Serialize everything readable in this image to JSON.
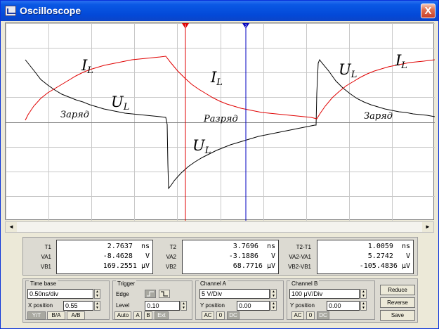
{
  "window": {
    "title": "Oscilloscope",
    "close_label": "X"
  },
  "scope": {
    "background": "#ffffff",
    "grid_color": "#c8c8c8",
    "trace_a_color": "#000000",
    "trace_b_color": "#e00000",
    "cursor1_color": "#e00000",
    "cursor2_color": "#0000c0",
    "cursor1_label": "1",
    "cursor2_label": "2",
    "annotations": {
      "il1": "I",
      "il1_sub": "L",
      "ul1": "U",
      "ul1_sub": "L",
      "il2": "I",
      "il2_sub": "L",
      "ul2": "U",
      "ul2_sub": "L",
      "ul3": "U",
      "ul3_sub": "L",
      "il3": "I",
      "il3_sub": "L",
      "zaryad1": "Заряд",
      "razryad": "Разряд",
      "zaryad2": "Заряд"
    }
  },
  "scrollbar": {
    "left": "◄",
    "right": "►"
  },
  "readout": {
    "t1": {
      "label": "T1",
      "value": "2.7637  ns"
    },
    "va1": {
      "label": "VA1",
      "value": "-8.4628   V"
    },
    "vb1": {
      "label": "VB1",
      "value": "169.2551 μV"
    },
    "t2": {
      "label": "T2",
      "value": "3.7696  ns"
    },
    "va2": {
      "label": "VA2",
      "value": "-3.1886   V"
    },
    "vb2": {
      "label": "VB2",
      "value": "68.7716 μV"
    },
    "dt": {
      "label": "T2-T1",
      "value": "1.0059  ns"
    },
    "dva": {
      "label": "VA2-VA1",
      "value": "5.2742   V"
    },
    "dvb": {
      "label": "VB2-VB1",
      "value": "-105.4836 μV"
    }
  },
  "timebase": {
    "title": "Time base",
    "scale": "0.50ns/div",
    "xpos_label": "X position",
    "xpos": "0.55",
    "yt": "Y/T",
    "ba": "B/A",
    "ab": "A/B"
  },
  "trigger": {
    "title": "Trigger",
    "edge_label": "Edge",
    "level_label": "Level",
    "level": "0.10",
    "auto": "Auto",
    "a": "A",
    "b": "B",
    "ext": "Ext"
  },
  "channel_a": {
    "title": "Channel A",
    "scale": "5 V/Div",
    "ypos_label": "Y position",
    "ypos": "0.00",
    "ac": "AC",
    "zero": "0",
    "dc": "DC"
  },
  "channel_b": {
    "title": "Channel B",
    "scale": "100 μV/Div",
    "ypos_label": "Y position",
    "ypos": "0.00",
    "ac": "AC",
    "zero": "0",
    "dc": "DC"
  },
  "buttons": {
    "reduce": "Reduce",
    "reverse": "Reverse",
    "save": "Save"
  }
}
